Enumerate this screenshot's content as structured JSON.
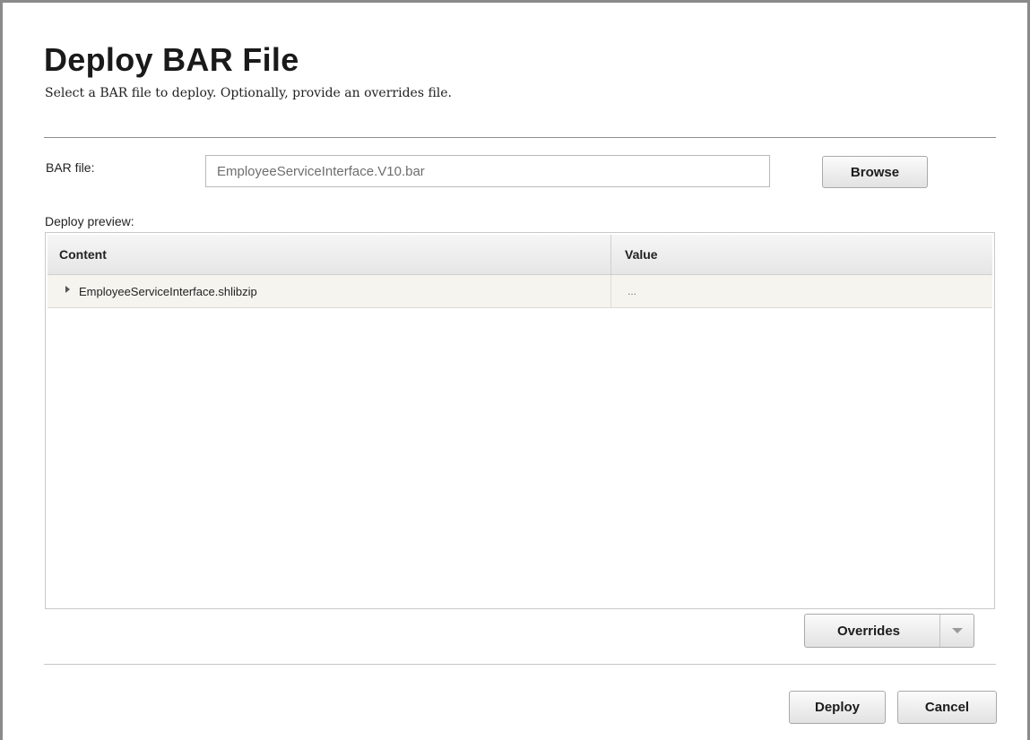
{
  "dialog": {
    "title": "Deploy BAR File",
    "subtitle": "Select a BAR file to deploy. Optionally, provide an overrides file."
  },
  "bar_file": {
    "label": "BAR file:",
    "value": "EmployeeServiceInterface.V10.bar",
    "browse_label": "Browse"
  },
  "preview": {
    "label": "Deploy preview:",
    "columns": [
      "Content",
      "Value"
    ],
    "rows": [
      {
        "content": "EmployeeServiceInterface.shlibzip",
        "value": "...",
        "expanded": false
      }
    ]
  },
  "overrides": {
    "label": "Overrides",
    "icon": "chevron-down-icon"
  },
  "actions": {
    "deploy_label": "Deploy",
    "cancel_label": "Cancel"
  }
}
